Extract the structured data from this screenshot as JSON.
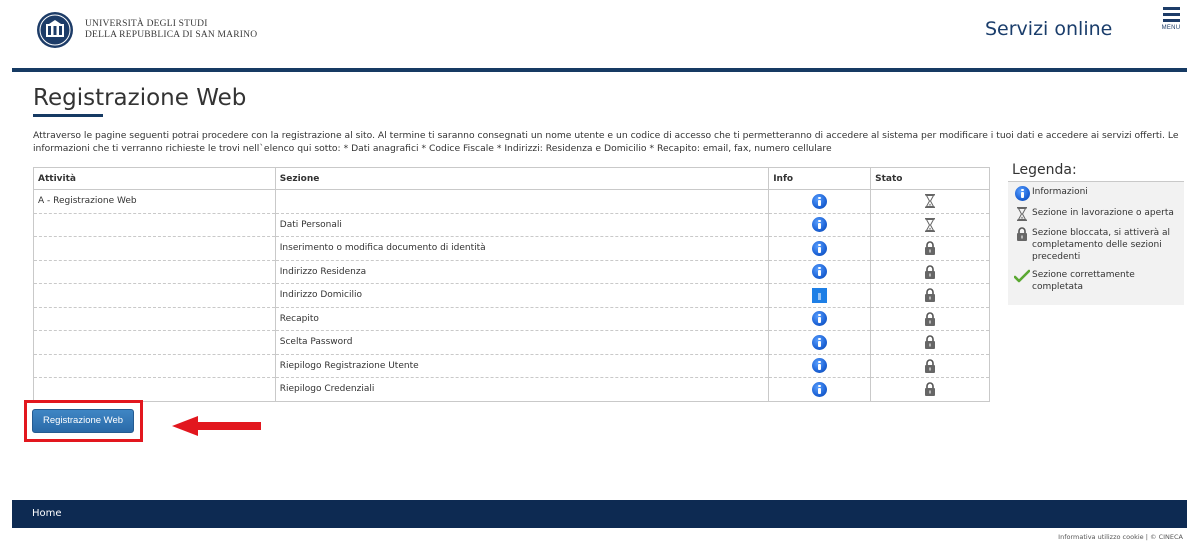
{
  "header": {
    "university_line1": "UNIVERSITÀ DEGLI STUDI",
    "university_line2": "DELLA REPUBBLICA DI SAN MARINO",
    "service_title": "Servizi online",
    "menu_label": "MENU",
    "logo_icon": "university-seal-icon",
    "menu_icon": "hamburger-menu-icon"
  },
  "page": {
    "title": "Registrazione Web",
    "intro": "Attraverso le pagine seguenti potrai procedere con la registrazione al sito. Al termine ti saranno consegnati un nome utente e un codice di accesso che ti permetteranno di accedere al sistema per modificare i tuoi dati e accedere ai servizi offerti. Le informazioni che ti verranno richieste le trovi nell`elenco qui sotto: * Dati anagrafici * Codice Fiscale * Indirizzi: Residenza e Domicilio * Recapito: email, fax, numero cellulare"
  },
  "table": {
    "headers": {
      "attivita": "Attività",
      "sezione": "Sezione",
      "info": "Info",
      "stato": "Stato"
    },
    "rows": [
      {
        "attivita": "A - Registrazione Web",
        "sezione": "",
        "info": "info-icon",
        "stato": "hourglass-icon"
      },
      {
        "attivita": "",
        "sezione": "Dati Personali",
        "info": "info-icon",
        "stato": "hourglass-icon"
      },
      {
        "attivita": "",
        "sezione": "Inserimento o modifica documento di identità",
        "info": "info-icon",
        "stato": "lock-icon"
      },
      {
        "attivita": "",
        "sezione": "Indirizzo Residenza",
        "info": "info-icon",
        "stato": "lock-icon"
      },
      {
        "attivita": "",
        "sezione": "Indirizzo Domicilio",
        "info": "info-square-icon",
        "stato": "lock-icon"
      },
      {
        "attivita": "",
        "sezione": "Recapito",
        "info": "info-icon",
        "stato": "lock-icon"
      },
      {
        "attivita": "",
        "sezione": "Scelta Password",
        "info": "info-icon",
        "stato": "lock-icon"
      },
      {
        "attivita": "",
        "sezione": "Riepilogo Registrazione Utente",
        "info": "info-icon",
        "stato": "lock-icon"
      },
      {
        "attivita": "",
        "sezione": "Riepilogo Credenziali",
        "info": "info-icon",
        "stato": "lock-icon"
      }
    ]
  },
  "legend": {
    "title": "Legenda:",
    "items": [
      {
        "icon": "info-icon",
        "label": "Informazioni"
      },
      {
        "icon": "hourglass-icon",
        "label": "Sezione in lavorazione o aperta"
      },
      {
        "icon": "lock-icon",
        "label": "Sezione bloccata, si attiverà al completamento delle sezioni precedenti"
      },
      {
        "icon": "check-icon",
        "label": "Sezione correttamente completata"
      }
    ]
  },
  "actions": {
    "register_button": "Registrazione Web",
    "annotation_icon": "red-arrow-icon"
  },
  "footer": {
    "home": "Home",
    "cookie_link": "Informativa utilizzo cookie",
    "separator": "|",
    "copyright": "© CINECA"
  },
  "colors": {
    "brand_navy": "#163a63",
    "footer_navy": "#0d2a52",
    "button_blue": "#2f75b5",
    "highlight_red": "#e2171e"
  }
}
